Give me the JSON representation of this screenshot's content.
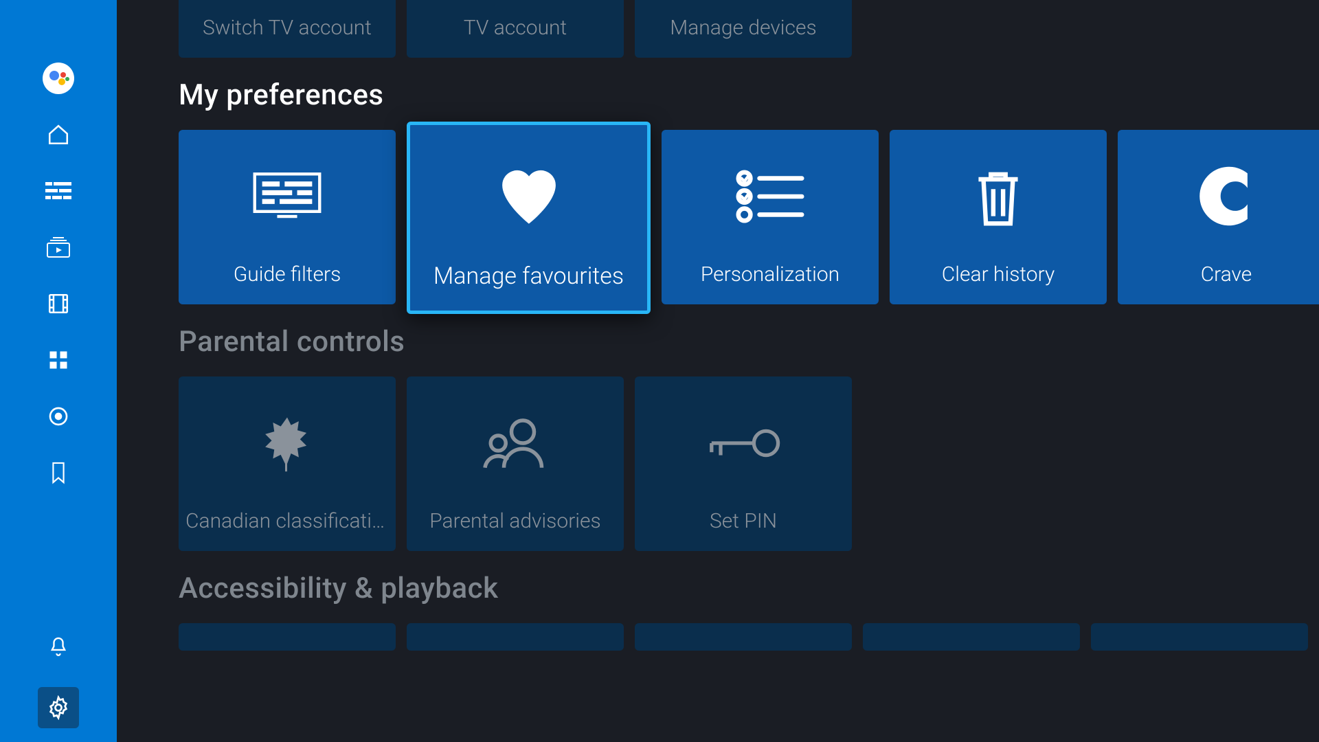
{
  "sidebar": {
    "items": [
      {
        "name": "assistant"
      },
      {
        "name": "home"
      },
      {
        "name": "guide"
      },
      {
        "name": "ondemand"
      },
      {
        "name": "movies"
      },
      {
        "name": "apps"
      },
      {
        "name": "record"
      },
      {
        "name": "bookmark"
      }
    ],
    "bottom": [
      {
        "name": "notifications"
      },
      {
        "name": "settings"
      }
    ],
    "selected": "settings"
  },
  "sections": {
    "account": {
      "tiles": [
        {
          "id": "switch-tv-account",
          "label": "Switch TV account",
          "icon": "switch"
        },
        {
          "id": "tv-account",
          "label": "TV account",
          "icon": "account"
        },
        {
          "id": "manage-devices",
          "label": "Manage devices",
          "icon": "devices"
        }
      ],
      "active": false
    },
    "preferences": {
      "title": "My preferences",
      "tiles": [
        {
          "id": "guide-filters",
          "label": "Guide filters",
          "icon": "guide-filters"
        },
        {
          "id": "manage-favourites",
          "label": "Manage favourites",
          "icon": "heart"
        },
        {
          "id": "personalization",
          "label": "Personalization",
          "icon": "checklist"
        },
        {
          "id": "clear-history",
          "label": "Clear history",
          "icon": "trash"
        },
        {
          "id": "crave",
          "label": "Crave",
          "icon": "crave"
        }
      ],
      "active": true,
      "focused": "manage-favourites"
    },
    "parental": {
      "title": "Parental controls",
      "tiles": [
        {
          "id": "canadian-classification",
          "label": "Canadian classificatio..",
          "icon": "maple"
        },
        {
          "id": "parental-advisories",
          "label": "Parental advisories",
          "icon": "people"
        },
        {
          "id": "set-pin",
          "label": "Set PIN",
          "icon": "key"
        }
      ],
      "active": false
    },
    "accessibility": {
      "title": "Accessibility & playback",
      "tiles": [
        {
          "id": "ap1"
        },
        {
          "id": "ap2"
        },
        {
          "id": "ap3"
        },
        {
          "id": "ap4"
        },
        {
          "id": "ap5"
        }
      ],
      "active": false
    }
  }
}
